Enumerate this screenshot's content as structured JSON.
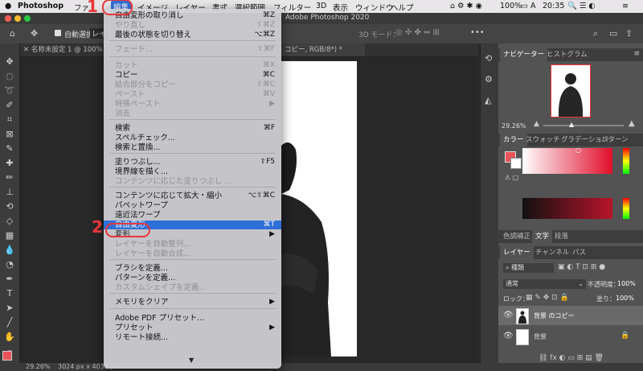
{
  "menubar": {
    "apple": "",
    "app": "Photoshop",
    "items": [
      "ファ",
      "編集",
      "イメージ",
      "レイヤー",
      "書式",
      "選択範囲",
      "フィルター",
      "3D",
      "表示",
      "ウィンドウ",
      "ヘルプ"
    ],
    "battery": "100%",
    "time": "20:35"
  },
  "titlebar": {
    "title": "Adobe Photoshop 2020"
  },
  "options": {
    "auto_select": "自動選択：",
    "auto_select_short": "レイ",
    "mode3d": "3D モード："
  },
  "doc_tabs": [
    "名称未設定 1 @ 100% (背景",
    "コピー, RGB/8*) *"
  ],
  "status": {
    "zoom": "29.26%",
    "size": "3024 px x 4032 px"
  },
  "menu": {
    "items": [
      {
        "label": "自由変形の取り消し",
        "shortcut": "⌘Z",
        "disabled": false,
        "sub": false
      },
      {
        "label": "やり直し",
        "shortcut": "⇧⌘Z",
        "disabled": true,
        "sub": false
      },
      {
        "label": "最後の状態を切り替え",
        "shortcut": "⌥⌘Z",
        "disabled": false,
        "sub": false
      },
      {
        "label": "フェード...",
        "shortcut": "⇧⌘F",
        "disabled": true,
        "sub": false
      },
      {
        "label": "カット",
        "shortcut": "⌘X",
        "disabled": true,
        "sub": false
      },
      {
        "label": "コピー",
        "shortcut": "⌘C",
        "disabled": false,
        "sub": false
      },
      {
        "label": "結合部分をコピー",
        "shortcut": "⇧⌘C",
        "disabled": true,
        "sub": false
      },
      {
        "label": "ペースト",
        "shortcut": "⌘V",
        "disabled": true,
        "sub": false
      },
      {
        "label": "特殊ペースト",
        "shortcut": "▶",
        "disabled": true,
        "sub": true
      },
      {
        "label": "消去",
        "shortcut": "",
        "disabled": true,
        "sub": false
      },
      {
        "label": "検索",
        "shortcut": "⌘F",
        "disabled": false,
        "sub": false
      },
      {
        "label": "スペルチェック...",
        "shortcut": "",
        "disabled": false,
        "sub": false
      },
      {
        "label": "検索と置換...",
        "shortcut": "",
        "disabled": false,
        "sub": false
      },
      {
        "label": "塗りつぶし...",
        "shortcut": "⇧F5",
        "disabled": false,
        "sub": false
      },
      {
        "label": "境界線を描く...",
        "shortcut": "",
        "disabled": false,
        "sub": false
      },
      {
        "label": "コンテンツに応じた塗りつぶし ...",
        "shortcut": "",
        "disabled": true,
        "sub": false
      },
      {
        "label": "コンテンツに応じて拡大・縮小",
        "shortcut": "⌥⇧⌘C",
        "disabled": false,
        "sub": false
      },
      {
        "label": "パペットワープ",
        "shortcut": "",
        "disabled": false,
        "sub": false
      },
      {
        "label": "遠近法ワープ",
        "shortcut": "",
        "disabled": false,
        "sub": false
      },
      {
        "label": "自由変形",
        "shortcut": "⌘T",
        "disabled": false,
        "sub": false
      },
      {
        "label": "変形",
        "shortcut": "▶",
        "disabled": false,
        "sub": true
      },
      {
        "label": "レイヤーを自動整列...",
        "shortcut": "",
        "disabled": true,
        "sub": false
      },
      {
        "label": "レイヤーを自動合成...",
        "shortcut": "",
        "disabled": true,
        "sub": false
      },
      {
        "label": "ブラシを定義...",
        "shortcut": "",
        "disabled": false,
        "sub": false
      },
      {
        "label": "パターンを定義...",
        "shortcut": "",
        "disabled": false,
        "sub": false
      },
      {
        "label": "カスタムシェイプを定義...",
        "shortcut": "",
        "disabled": true,
        "sub": false
      },
      {
        "label": "メモリをクリア",
        "shortcut": "▶",
        "disabled": false,
        "sub": true
      },
      {
        "label": "Adobe PDF プリセット...",
        "shortcut": "",
        "disabled": false,
        "sub": false
      },
      {
        "label": "プリセット",
        "shortcut": "▶",
        "disabled": false,
        "sub": true
      },
      {
        "label": "リモート接続...",
        "shortcut": "",
        "disabled": false,
        "sub": false
      }
    ],
    "more_arrow": "▼",
    "highlighted_index": 19
  },
  "badges": {
    "one": "1",
    "two": "2"
  },
  "panels": {
    "nav_tabs": [
      "ナビゲーター",
      "ヒストグラム"
    ],
    "nav_zoom": "29.26%",
    "color_tabs": [
      "カラー",
      "スウォッチ",
      "グラデーション",
      "パターン"
    ],
    "text_tabs": [
      "色調補正",
      "文字",
      "段落"
    ],
    "layer_tabs": [
      "レイヤー",
      "チャンネル",
      "パス"
    ],
    "layer_filter": "種類",
    "blend_mode": "通常",
    "opacity_label": "不透明度：",
    "opacity": "100%",
    "lock_label": "ロック：",
    "fill_label": "塗り：",
    "fill": "100%",
    "layers": [
      {
        "name": "背景 のコピー",
        "selected": true
      },
      {
        "name": "背景",
        "selected": false
      }
    ]
  },
  "colors": {
    "accent": "#2f6fd8",
    "annotation": "#e8373a",
    "foreground": "#e8545a",
    "background": "#ffffff"
  }
}
